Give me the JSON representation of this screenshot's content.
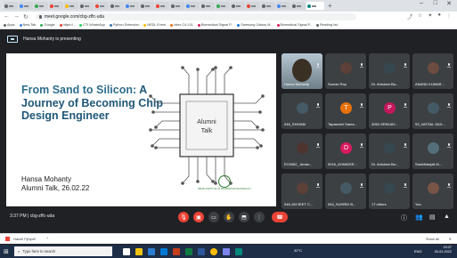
{
  "browser": {
    "url": "meet.google.com/cbg-zffc-uda",
    "bookmarks": [
      "Apps",
      "New Tab",
      "Google",
      "https://..",
      "CTI WhatsApp",
      "Python Extension",
      "NEDL Event",
      "Intex C4-101",
      "Biomedical Signal P..",
      "Samsung Galaxy M..",
      "Biomedical Signal P..",
      "Reading list"
    ]
  },
  "meet": {
    "presenting_text": "Hansa Mohanty is presenting",
    "time_code": "3:37 PM  |  cbg-zffc-uda"
  },
  "slide": {
    "title_a": "From Sand to Silicon:",
    "title_b": " A Journey of Becoming Chip Design Engineer",
    "chip_label_1": "Alumni",
    "chip_label_2": "Talk",
    "presenter": "Hansa Mohanty",
    "event": "Alumni Talk, 26.02.22",
    "logo_text": "INDIAN INSTITUTE OF INFORMATION TECHNOLOGY"
  },
  "participants": [
    {
      "name": "Hansa Mohanty",
      "initial": "",
      "color": "#8aa0b0",
      "video": true
    },
    {
      "name": "Suman Roy",
      "initial": "",
      "color": "#5d4037",
      "video": false
    },
    {
      "name": "Dr. Arindam Ba...",
      "initial": "",
      "color": "#37474f",
      "video": false
    },
    {
      "name": "ANAND KUMAR...",
      "initial": "",
      "color": "#6d4c41",
      "video": false
    },
    {
      "name": "046_SHIVAM",
      "initial": "",
      "color": "#455a64",
      "video": false
    },
    {
      "name": "Tapasmini Sama...",
      "initial": "T",
      "color": "#e8710a",
      "video": false
    },
    {
      "name": "4052-SRINJAY...",
      "initial": "P",
      "color": "#c2185b",
      "video": false
    },
    {
      "name": "93_VATSAL SAX...",
      "initial": "",
      "color": "#455a64",
      "video": false
    },
    {
      "name": "EC5062_ Aman...",
      "initial": "",
      "color": "#4e342e",
      "video": false
    },
    {
      "name": "0016_AYANDEE...",
      "initial": "D",
      "color": "#d81b60",
      "video": false
    },
    {
      "name": "Dr. Arindam Ba...",
      "initial": "",
      "color": "#37474f",
      "video": false
    },
    {
      "name": "Sraddhanjali M...",
      "initial": "",
      "color": "#546e7a",
      "video": false
    },
    {
      "name": "048-JAYJEET C...",
      "initial": "",
      "color": "#5d4037",
      "video": false
    },
    {
      "name": "054_SUHRID B...",
      "initial": "",
      "color": "#455a64",
      "video": false
    },
    {
      "name": "17 others",
      "initial": "",
      "color": "#37474f",
      "video": false
    },
    {
      "name": "You",
      "initial": "",
      "color": "#795548",
      "video": false
    }
  ],
  "download": {
    "file": "Hacell Fijhyclf",
    "show_all": "Show all"
  },
  "taskbar": {
    "search_placeholder": "Type here to search",
    "weather": "32°C",
    "lang": "ENG",
    "time": "15:37",
    "date": "26-02-2022"
  }
}
